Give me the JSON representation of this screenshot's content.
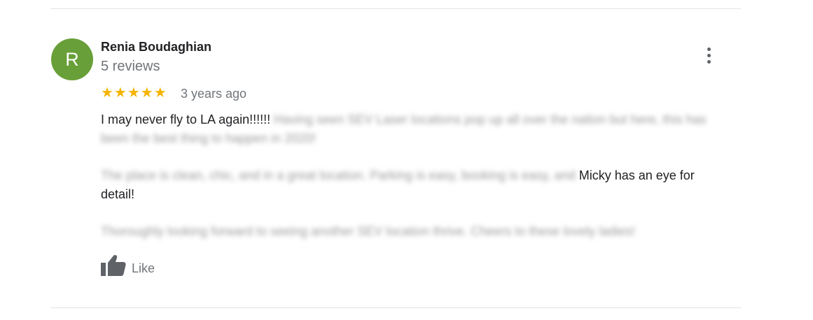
{
  "reviewer": {
    "initial": "R",
    "name": "Renia Boudaghian",
    "review_count": "5 reviews",
    "avatar_color": "#689f38"
  },
  "review": {
    "stars": "★★★★★",
    "rating": 5,
    "max_rating": 5,
    "star_color": "#f5b400",
    "date": "3 years ago",
    "p1_visible": "I may never fly to LA again!!!!!!",
    "p1_blurred": "Having seen SEV Laser locations pop up all over the nation but here, this has been the best thing to happen in 2020!",
    "p2_blurred": "The place is clean, chic, and in a great location. Parking is easy, booking is easy, and",
    "p2_visible": "Micky has an eye for detail!",
    "p3_blurred": "Thoroughly looking forward to seeing another SEV location thrive. Cheers to these lovely ladies!"
  },
  "actions": {
    "like_label": "Like",
    "more_icon": "more-vert-icon",
    "like_icon": "thumbs-up-icon"
  }
}
